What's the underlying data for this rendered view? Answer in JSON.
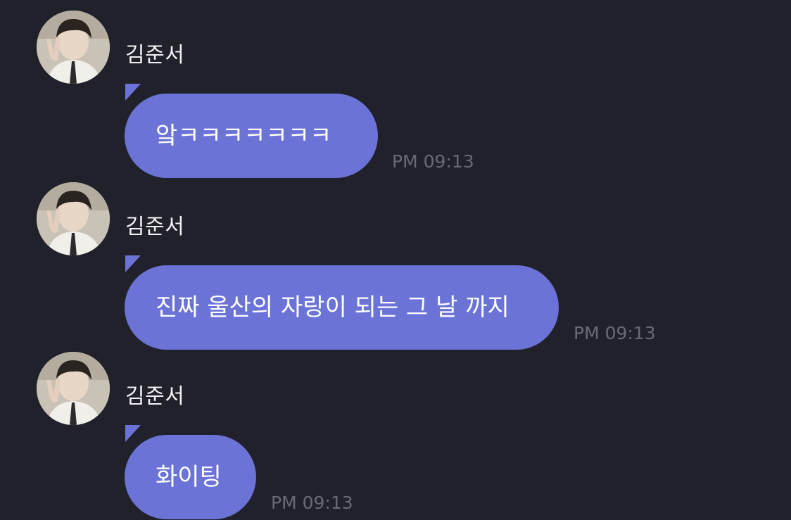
{
  "messages": [
    {
      "sender": "김준서",
      "text": "앜ㅋㅋㅋㅋㅋㅋㅋ",
      "time": "PM 09:13"
    },
    {
      "sender": "김준서",
      "text": "진짜 울산의 자랑이 되는 그 날 까지",
      "time": "PM 09:13"
    },
    {
      "sender": "김준서",
      "text": "화이팅",
      "time": "PM 09:13"
    }
  ],
  "colors": {
    "background": "#21212b",
    "bubble": "#6b73d6",
    "sender_text": "#f2f2f4",
    "message_text": "#ffffff",
    "timestamp": "#6a6a74"
  },
  "icons": {
    "avatar": "profile-photo-avatar"
  }
}
